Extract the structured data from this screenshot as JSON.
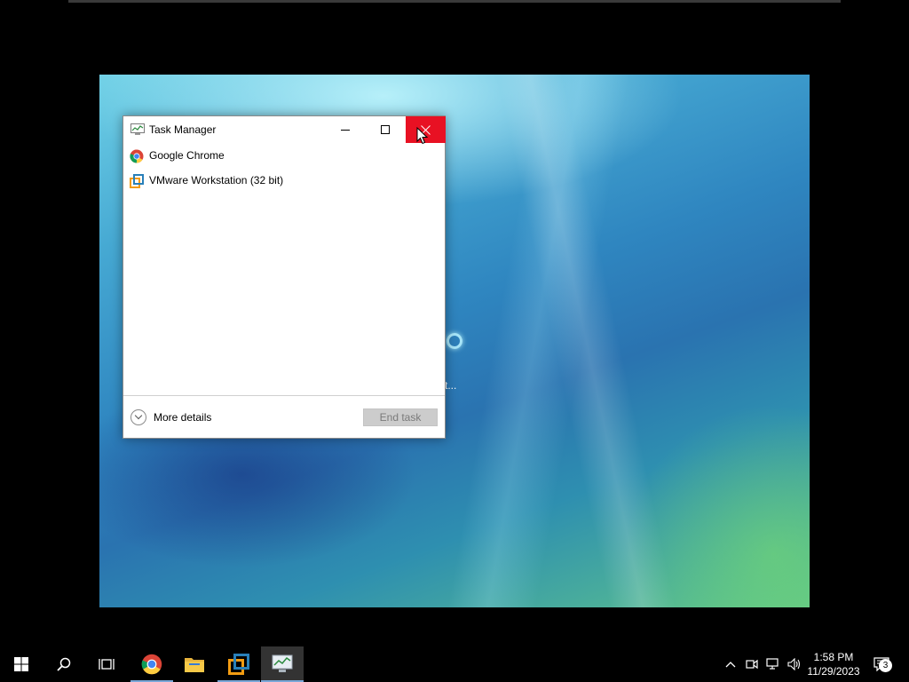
{
  "vm": {
    "status_text": "se wait..."
  },
  "task_manager": {
    "title": "Task Manager",
    "processes": [
      {
        "label": "Google Chrome",
        "icon": "chrome-icon"
      },
      {
        "label": "VMware Workstation (32 bit)",
        "icon": "vmware-icon"
      }
    ],
    "more_details_label": "More details",
    "end_task_label": "End task"
  },
  "taskbar": {
    "pinned": [
      {
        "name": "start-button",
        "icon": "windows-logo-icon"
      },
      {
        "name": "search-button",
        "icon": "search-icon"
      },
      {
        "name": "task-view-button",
        "icon": "task-view-icon"
      },
      {
        "name": "chrome-taskbar-button",
        "icon": "chrome-icon"
      },
      {
        "name": "file-explorer-taskbar-button",
        "icon": "folder-icon"
      },
      {
        "name": "vmware-taskbar-button",
        "icon": "vmware-icon"
      },
      {
        "name": "task-manager-taskbar-button",
        "icon": "task-manager-icon"
      }
    ],
    "clock_time": "1:58 PM",
    "clock_date": "11/29/2023",
    "notification_count": "3"
  },
  "colors": {
    "close_hover": "#e81123",
    "taskbar_bg": "#000000",
    "running_indicator": "#7aa7d8"
  }
}
